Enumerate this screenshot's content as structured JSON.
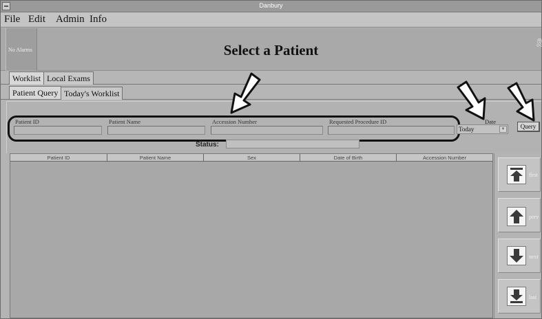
{
  "window": {
    "title": "Danbury"
  },
  "menu": {
    "items": [
      "File",
      "Edit",
      "Admin",
      "Info"
    ]
  },
  "header": {
    "alarms_label": "No Alarms",
    "page_title": "Select a Patient"
  },
  "tabs_primary": [
    "Worklist",
    "Local Exams"
  ],
  "tabs_secondary": [
    "Patient Query",
    "Today's Worklist"
  ],
  "query": {
    "patient_id_label": "Patient ID",
    "patient_name_label": "Patient Name",
    "accession_label": "Accession Number",
    "procedure_label": "Requested Procedure ID",
    "date_label": "Date",
    "date_value": "Today",
    "query_button": "Query",
    "status_label": "Status:"
  },
  "table": {
    "columns": [
      "Patient ID",
      "Patient Name",
      "Sex",
      "Date of Birth",
      "Accession Number"
    ]
  },
  "nav": {
    "buttons": [
      {
        "label": "first",
        "icon": "first-arrow-icon"
      },
      {
        "label": "prev",
        "icon": "up-arrow-icon"
      },
      {
        "label": "next",
        "icon": "down-arrow-icon"
      },
      {
        "label": "last",
        "icon": "last-arrow-icon"
      }
    ]
  },
  "colors": {
    "window_bg": "#b4b4b4",
    "title_bar": "#9a9a9a",
    "annotation": "#111111"
  }
}
